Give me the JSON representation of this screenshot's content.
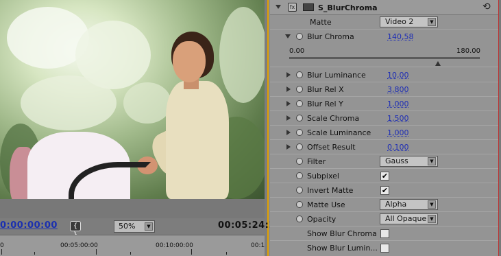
{
  "monitor": {
    "timecode_current": "0:00:00:00",
    "timecode_duration": "00:05:24:14",
    "zoom": {
      "value": "50%"
    },
    "ruler": [
      "0",
      "00:05:00:00",
      "00:10:00:00",
      "00:1"
    ],
    "bracket_icon": "{ }"
  },
  "effect": {
    "name": "S_BlurChroma",
    "reset_icon": "⟲",
    "matte": {
      "label": "Matte",
      "value": "Video 2"
    },
    "blur_chroma": {
      "label": "Blur Chroma",
      "value": "140,58",
      "slider_min": "0.00",
      "slider_max": "180.00",
      "slider_fraction": 0.78
    },
    "params": [
      {
        "label": "Blur Luminance",
        "value": "10,00"
      },
      {
        "label": "Blur Rel X",
        "value": "3,800"
      },
      {
        "label": "Blur Rel Y",
        "value": "1,000"
      },
      {
        "label": "Scale Chroma",
        "value": "1,500"
      },
      {
        "label": "Scale Luminance",
        "value": "1,000"
      },
      {
        "label": "Offset Result",
        "value": "0,100"
      }
    ],
    "filter": {
      "label": "Filter",
      "value": "Gauss"
    },
    "subpixel": {
      "label": "Subpixel",
      "checked": true
    },
    "invert_matte": {
      "label": "Invert Matte",
      "checked": true
    },
    "matte_use": {
      "label": "Matte Use",
      "value": "Alpha"
    },
    "opacity": {
      "label": "Opacity",
      "value": "All Opaque"
    },
    "show_blur_chroma": {
      "label": "Show Blur Chroma",
      "checked": false
    },
    "show_blur_luminance": {
      "label": "Show Blur Lumin...",
      "checked": false
    },
    "checkmark": "✔",
    "dropdown_arrow": "▼"
  }
}
